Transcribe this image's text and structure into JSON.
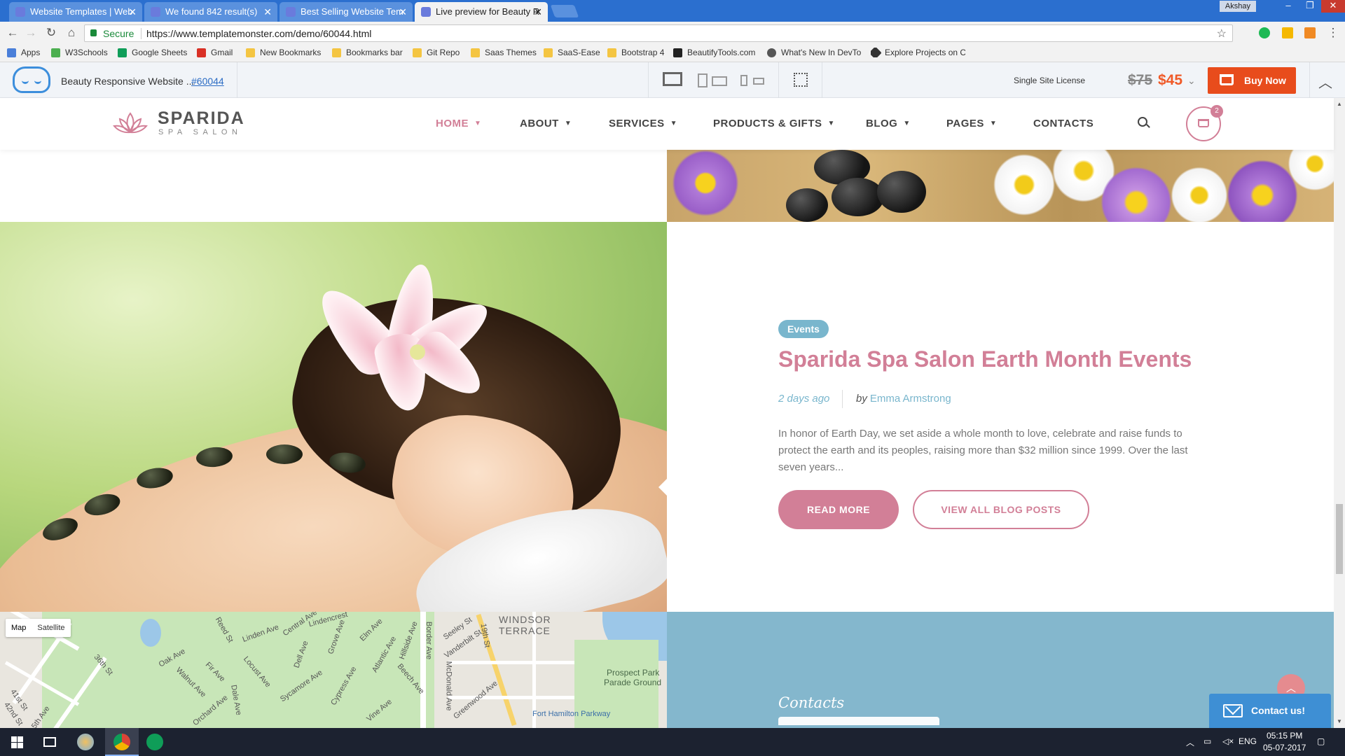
{
  "browser": {
    "tabs": [
      {
        "label": "Website Templates | Web"
      },
      {
        "label": "We found 842 result(s)"
      },
      {
        "label": "Best Selling Website Tem"
      },
      {
        "label": "Live preview for Beauty R"
      }
    ],
    "user": "Akshay",
    "secure_label": "Secure",
    "url": "https://www.templatemonster.com/demo/60044.html",
    "bookmarks": [
      {
        "label": "Apps",
        "color": "#4a7fd9"
      },
      {
        "label": "W3Schools",
        "color": "#4caf50"
      },
      {
        "label": "Google Sheets",
        "color": "#0f9d58"
      },
      {
        "label": "Gmail",
        "color": "#d93025"
      },
      {
        "label": "New Bookmarks",
        "color": "#f4c542"
      },
      {
        "label": "Bookmarks bar",
        "color": "#f4c542"
      },
      {
        "label": "Git Repo",
        "color": "#f4c542"
      },
      {
        "label": "Saas Themes",
        "color": "#f4c542"
      },
      {
        "label": "SaaS-Ease",
        "color": "#f4c542"
      },
      {
        "label": "Bootstrap 4",
        "color": "#f4c542"
      },
      {
        "label": "BeautifyTools.com",
        "color": "#222222"
      },
      {
        "label": "What's New In DevTo",
        "color": "#555555"
      },
      {
        "label": "Explore Projects on C",
        "color": "#333333"
      }
    ]
  },
  "tmbar": {
    "title": "Beauty Responsive Website ...",
    "template_id": "#60044",
    "license": "Single Site License",
    "old_price": "$75",
    "new_price": "$45",
    "buy_label": "Buy Now",
    "accent": "#e84c1c"
  },
  "site": {
    "brand": "SPARIDA",
    "brand_sub": "SPA SALON",
    "accent": "#d27f97",
    "nav": [
      {
        "label": "HOME",
        "active": true
      },
      {
        "label": "ABOUT"
      },
      {
        "label": "SERVICES"
      },
      {
        "label": "PRODUCTS & GIFTS"
      },
      {
        "label": "BLOG"
      },
      {
        "label": "PAGES"
      },
      {
        "label": "CONTACTS"
      }
    ],
    "cart_count": "2"
  },
  "post": {
    "tag": "Events",
    "title": "Sparida Spa Salon Earth Month Events",
    "date": "2 days ago",
    "by": "by",
    "author": "Emma Armstrong",
    "excerpt": "In honor of Earth Day, we set aside a whole month to love, celebrate and raise funds to protect the earth and its peoples, raising more than $32 million since 1999. Over the last seven years...",
    "read_more": "READ MORE",
    "view_all": "VIEW ALL BLOG POSTS",
    "tag_color": "#79b6cd"
  },
  "map": {
    "type_buttons": [
      "Map",
      "Satellite"
    ],
    "labels": [
      "WINDSOR TERRACE",
      "Prospect Park",
      "Parade Ground",
      "Fort Hamilton Parkway",
      "Central Ave",
      "Elm Ave",
      "Grove Ave",
      "Oak Ave",
      "Locust Ave",
      "Beech Ave",
      "Vine Ave",
      "Cypress Ave",
      "McDonald Ave",
      "Greenwood Ave",
      "Vanderbilt St",
      "Seeley St",
      "Border Ave",
      "36th St",
      "41st St",
      "42nd St",
      "5th Ave",
      "Orchard Ave",
      "Dale Ave",
      "Atlantic Ave",
      "Hillside Ave",
      "Lindencrest",
      "19th St",
      "Linden Ave",
      "Reed St",
      "Dell Ave",
      "Sycamore Ave",
      "Fir Ave",
      "Walnut Ave"
    ]
  },
  "contacts": {
    "label": "Contacts",
    "bg": "#84b7cd"
  },
  "widget": {
    "contact_us": "Contact us!"
  },
  "taskbar": {
    "lang": "ENG",
    "time": "05:15 PM",
    "date": "05-07-2017"
  }
}
